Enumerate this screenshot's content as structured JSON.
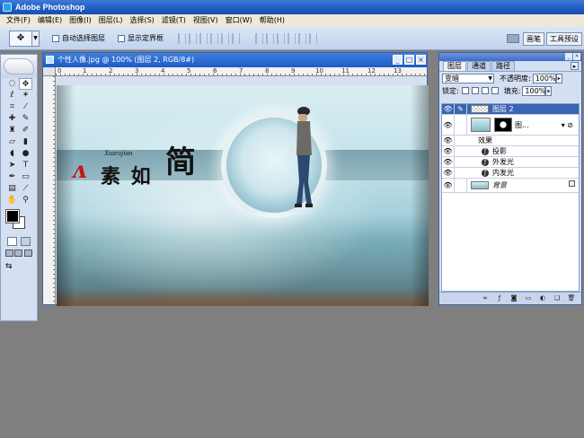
{
  "app": {
    "title": "Adobe Photoshop"
  },
  "menu": [
    "文件(F)",
    "编辑(E)",
    "图像(I)",
    "图层(L)",
    "选择(S)",
    "滤镜(T)",
    "视图(V)",
    "窗口(W)",
    "帮助(H)"
  ],
  "options": {
    "auto_select": "自动选择图层",
    "show_bounds": "显示定界框",
    "well_tabs": [
      "画笔",
      "工具预设"
    ]
  },
  "document": {
    "title": "个性人像.jpg @ 100% (图层 2, RGB/8#)",
    "ruler_numbers": [
      "0",
      "1",
      "2",
      "3",
      "4",
      "5",
      "6",
      "7",
      "8",
      "9",
      "10",
      "11",
      "12",
      "13"
    ]
  },
  "artwork": {
    "pinyin": "Xsurujian",
    "text_cn": "素 如",
    "text_big": "简",
    "swoosh": "ʌ"
  },
  "layers_panel": {
    "tabs": [
      "图层",
      "通道",
      "路径"
    ],
    "blend_mode": "变暗",
    "opacity_label": "不透明度:",
    "opacity": "100%",
    "lock_label": "锁定:",
    "fill_label": "填充:",
    "fill": "100%",
    "layers": [
      {
        "name": "图层 2",
        "selected": true
      },
      {
        "name": "图...",
        "selected": false
      },
      {
        "name": "效果",
        "selected": false
      },
      {
        "name": "投影",
        "selected": false
      },
      {
        "name": "外发光",
        "selected": false
      },
      {
        "name": "内发光",
        "selected": false
      },
      {
        "name": "背景",
        "selected": false
      }
    ]
  }
}
